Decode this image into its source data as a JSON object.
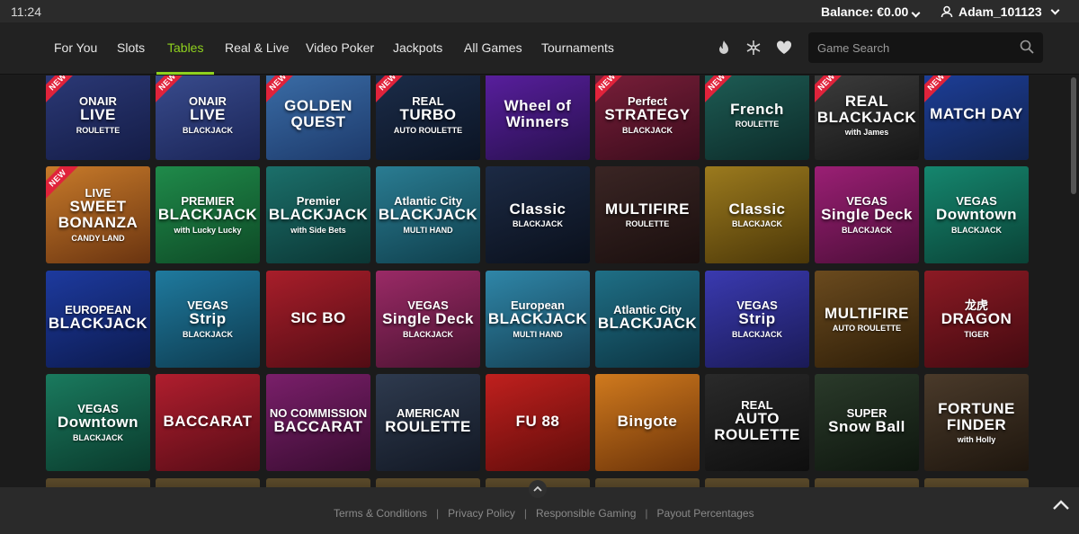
{
  "status": {
    "time": "11:24",
    "balance": "Balance: €0.00",
    "username": "Adam_101123"
  },
  "nav": {
    "items": [
      {
        "label": "For You"
      },
      {
        "label": "Slots"
      },
      {
        "label": "Tables"
      },
      {
        "label": "Real & Live"
      },
      {
        "label": "Video Poker"
      },
      {
        "label": "Jackpots"
      },
      {
        "label": "All Games"
      },
      {
        "label": "Tournaments"
      }
    ],
    "active": "Tables",
    "search_placeholder": "Game Search"
  },
  "colors": {
    "accent": "#8fd11e",
    "new_badge": "#e0233b",
    "background": "#1b1b1b"
  },
  "badge_label": "NEW",
  "games": [
    {
      "lines": [
        "ONAIR",
        "LIVE",
        "ROULETTE"
      ],
      "bg": "linear-gradient(160deg,#2c3a78,#141c46)",
      "new": true
    },
    {
      "lines": [
        "ONAIR",
        "LIVE",
        "BLACKJACK"
      ],
      "bg": "linear-gradient(160deg,#3a4d8f,#1a2456)",
      "new": true
    },
    {
      "lines": [
        "",
        "GOLDEN QUEST",
        ""
      ],
      "bg": "linear-gradient(160deg,#3b6ea8,#1d3a6b)",
      "new": true
    },
    {
      "lines": [
        "REAL",
        "TURBO",
        "AUTO ROULETTE"
      ],
      "bg": "linear-gradient(160deg,#1c2d4a,#0b1424)",
      "new": true
    },
    {
      "lines": [
        "",
        "Wheel of Winners",
        ""
      ],
      "bg": "linear-gradient(160deg,#5a1fa0,#27104d)",
      "new": false
    },
    {
      "lines": [
        "Perfect",
        "STRATEGY",
        "BLACKJACK"
      ],
      "bg": "linear-gradient(160deg,#7a1f3a,#3b0c1c)",
      "new": true
    },
    {
      "lines": [
        "",
        "French",
        "ROULETTE"
      ],
      "bg": "linear-gradient(160deg,#1e5e56,#0c2a28)",
      "new": true
    },
    {
      "lines": [
        "",
        "REAL BLACKJACK",
        "with James"
      ],
      "bg": "linear-gradient(160deg,#3d3d3d,#161616)",
      "new": true
    },
    {
      "lines": [
        "",
        "MATCH DAY",
        ""
      ],
      "bg": "linear-gradient(160deg,#1d3f9a,#11224d)",
      "new": true
    },
    {
      "lines": [
        "LIVE",
        "SWEET BONANZA",
        "CANDY LAND"
      ],
      "bg": "linear-gradient(160deg,#c77a2a,#6a3410)",
      "new": true
    },
    {
      "lines": [
        "PREMIER",
        "BLACKJACK",
        "with Lucky Lucky"
      ],
      "bg": "linear-gradient(160deg,#1f8a4a,#0e4a26)",
      "new": false
    },
    {
      "lines": [
        "Premier",
        "BLACKJACK",
        "with Side Bets"
      ],
      "bg": "linear-gradient(160deg,#1b6f6a,#0b3634)",
      "new": false
    },
    {
      "lines": [
        "Atlantic City",
        "BLACKJACK",
        "MULTI HAND"
      ],
      "bg": "linear-gradient(160deg,#2a7c92,#0f3f4c)",
      "new": false
    },
    {
      "lines": [
        "",
        "Classic",
        "BLACKJACK"
      ],
      "bg": "linear-gradient(160deg,#1c2a44,#0a101c)",
      "new": false
    },
    {
      "lines": [
        "",
        "MULTIFIRE",
        "ROULETTE"
      ],
      "bg": "linear-gradient(160deg,#3a2524,#1a0f0e)",
      "new": false
    },
    {
      "lines": [
        "",
        "Classic",
        "BLACKJACK"
      ],
      "bg": "linear-gradient(160deg,#9b7a1e,#4b3708)",
      "new": false
    },
    {
      "lines": [
        "VEGAS",
        "Single Deck",
        "BLACKJACK"
      ],
      "bg": "linear-gradient(160deg,#9a1f74,#4c0e38)",
      "new": false
    },
    {
      "lines": [
        "VEGAS",
        "Downtown",
        "BLACKJACK"
      ],
      "bg": "linear-gradient(160deg,#15866e,#0a4236)",
      "new": false
    },
    {
      "lines": [
        "EUROPEAN",
        "BLACKJACK",
        ""
      ],
      "bg": "linear-gradient(160deg,#1d3a9e,#0c1a4e)",
      "new": false
    },
    {
      "lines": [
        "VEGAS",
        "Strip",
        "BLACKJACK"
      ],
      "bg": "linear-gradient(160deg,#1f7a9e,#0d3a4e)",
      "new": false
    },
    {
      "lines": [
        "",
        "SIC BO",
        ""
      ],
      "bg": "linear-gradient(160deg,#a81e2a,#520c14)",
      "new": false
    },
    {
      "lines": [
        "VEGAS",
        "Single Deck",
        "BLACKJACK"
      ],
      "bg": "linear-gradient(160deg,#9a2a66,#4a1230)",
      "new": false
    },
    {
      "lines": [
        "European",
        "BLACKJACK",
        "MULTI HAND"
      ],
      "bg": "linear-gradient(160deg,#2f86a8,#143f52)",
      "new": false
    },
    {
      "lines": [
        "Atlantic City",
        "BLACKJACK",
        ""
      ],
      "bg": "linear-gradient(160deg,#1f6f86,#0b3340)",
      "new": false
    },
    {
      "lines": [
        "VEGAS",
        "Strip",
        "BLACKJACK"
      ],
      "bg": "linear-gradient(160deg,#3a3ab0,#1a1a56)",
      "new": false
    },
    {
      "lines": [
        "",
        "MULTIFIRE",
        "AUTO ROULETTE"
      ],
      "bg": "linear-gradient(160deg,#6a4a1e,#2e1e08)",
      "new": false
    },
    {
      "lines": [
        "龙虎",
        "DRAGON",
        "TIGER"
      ],
      "bg": "linear-gradient(160deg,#8c1a24,#420a10)",
      "new": false
    },
    {
      "lines": [
        "VEGAS",
        "Downtown",
        "BLACKJACK"
      ],
      "bg": "linear-gradient(160deg,#1a7a5e,#0a3a2c)",
      "new": false
    },
    {
      "lines": [
        "",
        "BACCARAT",
        ""
      ],
      "bg": "linear-gradient(160deg,#b01e2e,#560c16)",
      "new": false
    },
    {
      "lines": [
        "NO COMMISSION",
        "BACCARAT",
        ""
      ],
      "bg": "linear-gradient(160deg,#7a1f6a,#380c30)",
      "new": false
    },
    {
      "lines": [
        "AMERICAN",
        "ROULETTE",
        ""
      ],
      "bg": "linear-gradient(160deg,#2e3a4e,#121824)",
      "new": false
    },
    {
      "lines": [
        "",
        "FU 88",
        ""
      ],
      "bg": "linear-gradient(160deg,#c0201e,#5e0c0a)",
      "new": false
    },
    {
      "lines": [
        "",
        "Bingote",
        ""
      ],
      "bg": "linear-gradient(160deg,#d07a1e,#6a3208)",
      "new": false
    },
    {
      "lines": [
        "REAL",
        "AUTO ROULETTE",
        ""
      ],
      "bg": "linear-gradient(160deg,#2a2a2a,#0e0e0e)",
      "new": false
    },
    {
      "lines": [
        "SUPER",
        "Snow Ball",
        ""
      ],
      "bg": "linear-gradient(160deg,#2a3a2a,#0e160e)",
      "new": false
    },
    {
      "lines": [
        "",
        "FORTUNE FINDER",
        "with Holly"
      ],
      "bg": "linear-gradient(160deg,#4a3a2a,#1e160e)",
      "new": false
    }
  ],
  "footer": {
    "links": [
      "Terms & Conditions",
      "Privacy Policy",
      "Responsible Gaming",
      "Payout Percentages"
    ],
    "separator": "|"
  }
}
